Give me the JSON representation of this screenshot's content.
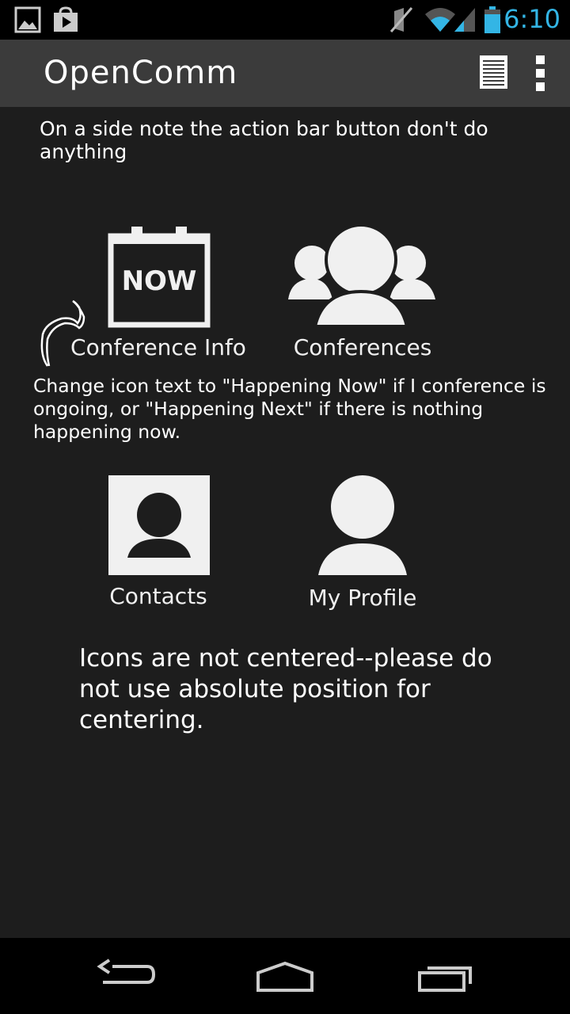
{
  "status_bar": {
    "time": "6:10",
    "icons": [
      "gallery-notification-icon",
      "play-store-notification-icon",
      "mute-icon",
      "wifi-icon",
      "signal-icon",
      "battery-icon"
    ]
  },
  "action_bar": {
    "title": "OpenComm",
    "buttons": [
      "list-view-icon",
      "overflow-menu-icon"
    ]
  },
  "notes": {
    "top": "On a side note the action bar button don't do anything",
    "middle": "Change icon text to \"Happening Now\" if I conference is ongoing, or \"Happening Next\" if there is nothing happening now.",
    "bottom": "Icons are not centered--please do not use absolute position for centering."
  },
  "tiles": [
    {
      "label": "Conference Info",
      "icon": "calendar-now-icon",
      "icon_text": "NOW"
    },
    {
      "label": "Conferences",
      "icon": "group-icon"
    },
    {
      "label": "Contacts",
      "icon": "contact-card-icon"
    },
    {
      "label": "My Profile",
      "icon": "person-icon"
    }
  ],
  "colors": {
    "background": "#1d1d1d",
    "action_bar": "#3b3b3b",
    "accent": "#33b5e5",
    "icon": "#f0f0f0"
  }
}
